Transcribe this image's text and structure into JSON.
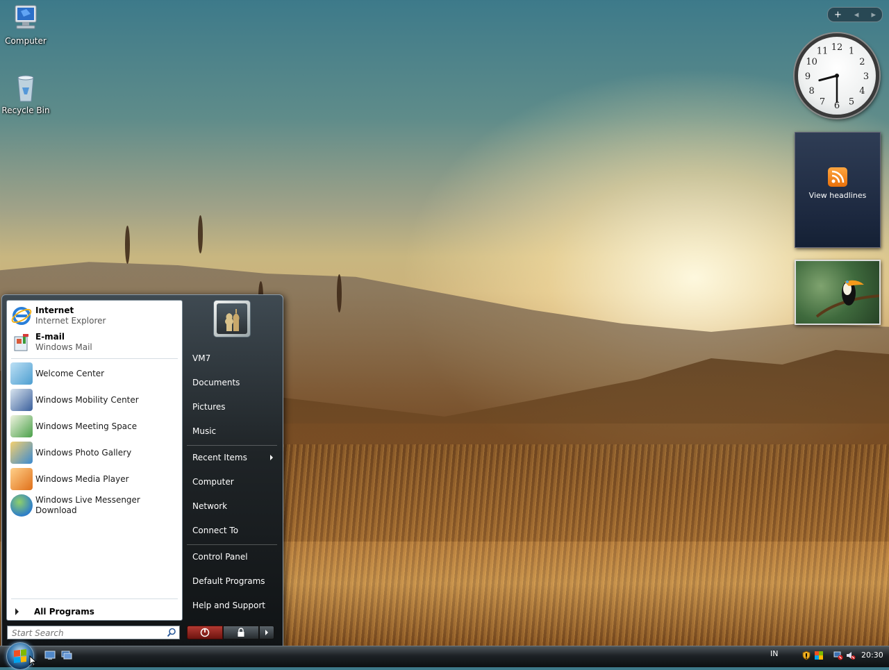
{
  "desktop": {
    "icons": [
      {
        "label": "Computer"
      },
      {
        "label": "Recycle Bin"
      }
    ]
  },
  "gadgets": {
    "controls": {
      "add": "+",
      "prev": "◂",
      "next": "▸"
    },
    "clock": {
      "numerals": [
        "12",
        "1",
        "2",
        "3",
        "4",
        "5",
        "6",
        "7",
        "8",
        "9",
        "10",
        "11"
      ],
      "time": "20:30"
    },
    "feed": {
      "label": "View headlines"
    }
  },
  "start_menu": {
    "pinned": [
      {
        "title": "Internet",
        "subtitle": "Internet Explorer"
      },
      {
        "title": "E-mail",
        "subtitle": "Windows Mail"
      }
    ],
    "recent": [
      {
        "label": "Welcome Center"
      },
      {
        "label": "Windows Mobility Center"
      },
      {
        "label": "Windows Meeting Space"
      },
      {
        "label": "Windows Photo Gallery"
      },
      {
        "label": "Windows Media Player"
      },
      {
        "label": "Windows Live Messenger Download"
      }
    ],
    "all_programs": "All Programs",
    "search_placeholder": "Start Search",
    "right": {
      "user": "VM7",
      "group1": [
        "Documents",
        "Pictures",
        "Music"
      ],
      "group2": [
        "Recent Items",
        "Computer",
        "Network",
        "Connect To"
      ],
      "group3": [
        "Control Panel",
        "Default Programs",
        "Help and Support"
      ]
    }
  },
  "taskbar": {
    "language": "IN",
    "time": "20:30"
  },
  "colors": {
    "taskbar_dark": "#0d1012",
    "menu_accent": "#3a7bb0",
    "power_red": "#b43a32"
  }
}
